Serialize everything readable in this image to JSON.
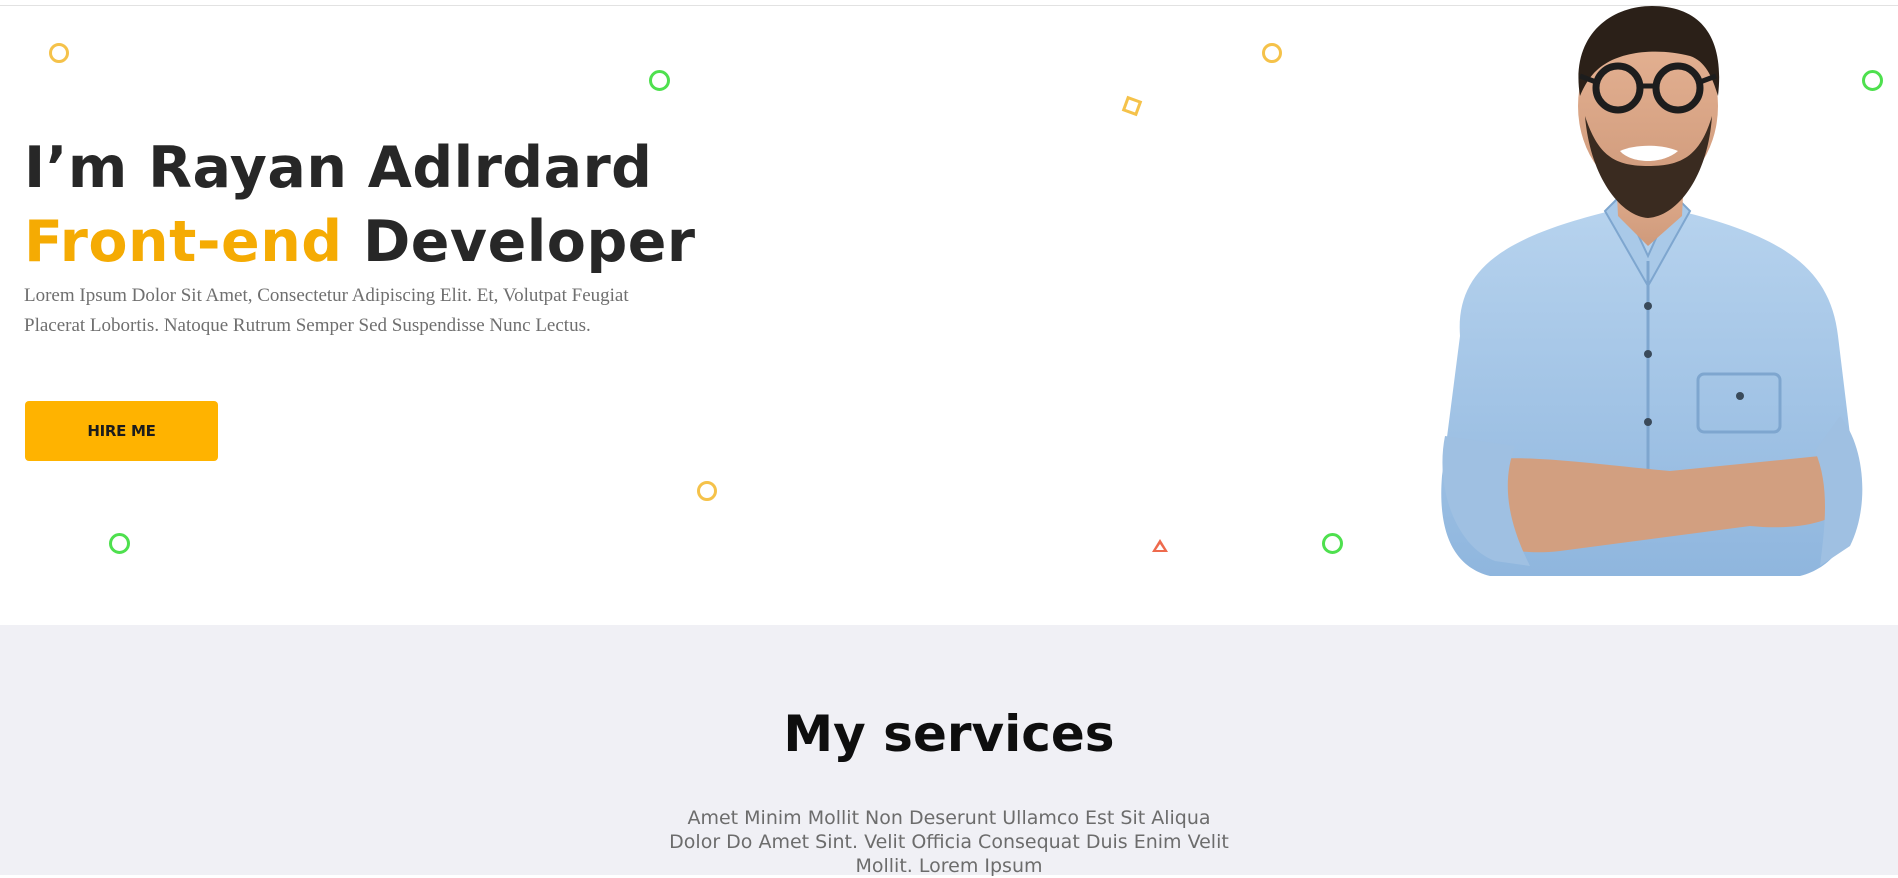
{
  "hero": {
    "headline_line1": "I’m Rayan Adlrdard",
    "headline_accent": "Front-end",
    "headline_rest": "Developer",
    "intro": "Lorem Ipsum Dolor Sit Amet, Consectetur Adipiscing Elit. Et, Volutpat Feugiat Placerat Lobortis. Natoque Rutrum Semper Sed Suspendisse Nunc Lectus.",
    "hire_button_label": "HIRE ME",
    "portrait_alt": "Smiling man with glasses and denim shirt, arms crossed"
  },
  "services": {
    "title": "My services",
    "description": "Amet Minim Mollit Non Deserunt Ullamco Est Sit Aliqua Dolor Do Amet Sint. Velit Officia Consequat Duis Enim Velit Mollit. Lorem Ipsum"
  },
  "colors": {
    "accent": "#ffb300",
    "headline_accent": "#f5ab03",
    "heading": "#272727",
    "services_bg": "#f0f0f5",
    "deco_yellow": "#f5c24a",
    "deco_green": "#4ee04e",
    "deco_red": "#ee6a4d"
  }
}
